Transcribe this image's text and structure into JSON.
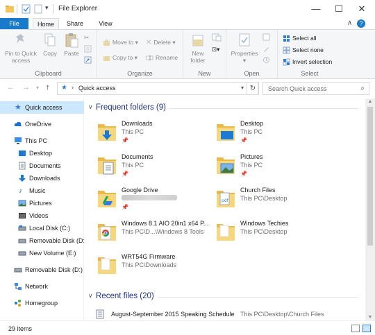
{
  "window": {
    "title": "File Explorer",
    "controls": {
      "minimize": "—",
      "maximize": "☐",
      "close": "✕"
    }
  },
  "ribbon_tabs": [
    {
      "label": "File",
      "active": false
    },
    {
      "label": "Home",
      "active": true
    },
    {
      "label": "Share",
      "active": false
    },
    {
      "label": "View",
      "active": false
    }
  ],
  "ribbon": {
    "clipboard": {
      "label": "Clipboard",
      "pin": "Pin to Quick access",
      "pin_line1": "Pin to Quick",
      "pin_line2": "access",
      "copy": "Copy",
      "paste": "Paste"
    },
    "organize": {
      "label": "Organize",
      "move_to": "Move to",
      "copy_to": "Copy to",
      "delete": "Delete",
      "rename": "Rename"
    },
    "new": {
      "label": "New",
      "new_folder_line1": "New",
      "new_folder_line2": "folder"
    },
    "open": {
      "label": "Open",
      "properties": "Properties"
    },
    "select": {
      "label": "Select",
      "select_all": "Select all",
      "select_none": "Select none",
      "invert_selection": "Invert selection"
    }
  },
  "address_bar": {
    "path": "Quick access",
    "search_placeholder": "Search Quick access"
  },
  "sidebar": [
    {
      "label": "Quick access",
      "icon": "star-icon",
      "selected": true
    },
    {
      "label": "OneDrive",
      "icon": "cloud-icon"
    },
    {
      "label": "This PC",
      "icon": "computer-icon"
    },
    {
      "label": "Desktop",
      "icon": "desktop-icon"
    },
    {
      "label": "Documents",
      "icon": "documents-icon"
    },
    {
      "label": "Downloads",
      "icon": "download-icon"
    },
    {
      "label": "Music",
      "icon": "music-icon"
    },
    {
      "label": "Pictures",
      "icon": "pictures-icon"
    },
    {
      "label": "Videos",
      "icon": "videos-icon"
    },
    {
      "label": "Local Disk (C:)",
      "icon": "drive-icon"
    },
    {
      "label": "Removable Disk (D:",
      "icon": "removable-drive-icon"
    },
    {
      "label": "New Volume (E:)",
      "icon": "drive-icon"
    },
    {
      "label": "Removable Disk (D:)",
      "icon": "removable-drive-icon"
    },
    {
      "label": "Network",
      "icon": "network-icon"
    },
    {
      "label": "Homegroup",
      "icon": "homegroup-icon"
    }
  ],
  "frequent": {
    "title": "Frequent folders (9)",
    "items": [
      {
        "name": "Downloads",
        "location": "This PC",
        "pinned": true,
        "icon": "downloads-folder-icon"
      },
      {
        "name": "Desktop",
        "location": "This PC",
        "pinned": true,
        "icon": "desktop-folder-icon"
      },
      {
        "name": "Documents",
        "location": "This PC",
        "pinned": true,
        "icon": "documents-folder-icon"
      },
      {
        "name": "Pictures",
        "location": "This PC",
        "pinned": true,
        "icon": "pictures-folder-icon"
      },
      {
        "name": "Google Drive",
        "location": "",
        "pinned": true,
        "icon": "google-drive-folder-icon"
      },
      {
        "name": "Church Files",
        "location": "This PC\\Desktop",
        "pinned": false,
        "icon": "pdf-folder-icon"
      },
      {
        "name": "Windows 8.1 AIO 20in1 x64 P...",
        "location": "This PC\\D...\\Windows 8 Tools",
        "pinned": false,
        "icon": "chrome-folder-icon"
      },
      {
        "name": "Windows Techies",
        "location": "This PC\\Desktop",
        "pinned": false,
        "icon": "folder-icon"
      },
      {
        "name": "WRT54G Firmware",
        "location": "This PC\\Downloads",
        "pinned": false,
        "icon": "folder-icon"
      }
    ]
  },
  "recent": {
    "title": "Recent files (20)",
    "items": [
      {
        "name": "August-September 2015 Speaking Schedule",
        "location": "This PC\\Desktop\\Church Files"
      }
    ]
  },
  "status": {
    "item_count": "29 items"
  },
  "colors": {
    "file_tab": "#1979ca",
    "selection": "#cce8ff",
    "section_title": "#1e3287",
    "folder": "#f3d27a"
  }
}
